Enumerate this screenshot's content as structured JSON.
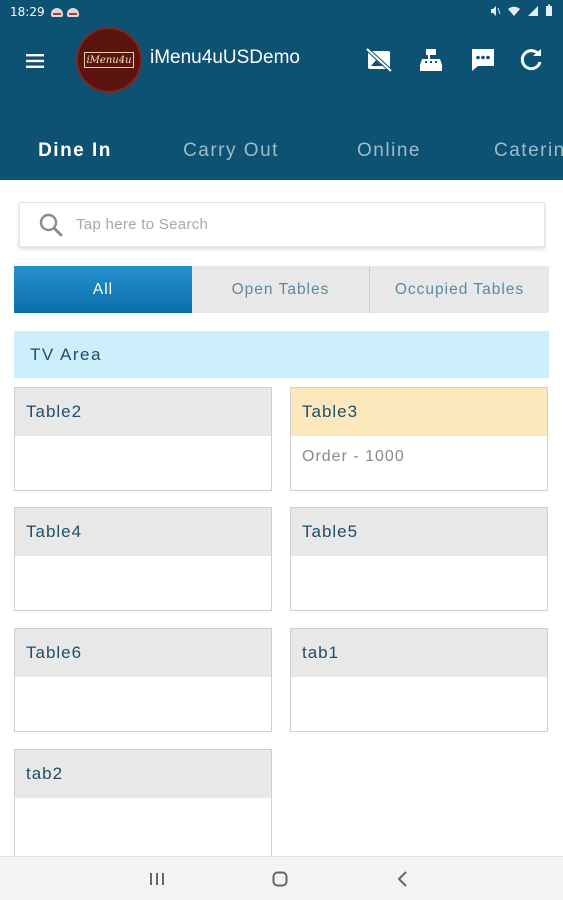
{
  "status_bar": {
    "time": "18:29"
  },
  "app": {
    "title": "iMenu4uUSDemo",
    "logo_text": "iMenu4u"
  },
  "tabs": [
    {
      "label": "Dine In",
      "active": true
    },
    {
      "label": "Carry Out",
      "active": false
    },
    {
      "label": "Online",
      "active": false
    },
    {
      "label": "Catering",
      "active": false
    }
  ],
  "search": {
    "placeholder": "Tap here to Search"
  },
  "filters": [
    {
      "label": "All",
      "active": true
    },
    {
      "label": "Open Tables",
      "active": false
    },
    {
      "label": "Occupied Tables",
      "active": false
    }
  ],
  "area": {
    "name": "TV Area"
  },
  "tables": [
    {
      "name": "Table2",
      "status": "open",
      "detail": ""
    },
    {
      "name": "Table3",
      "status": "occupied",
      "detail": "Order -  1000"
    },
    {
      "name": "Table4",
      "status": "open",
      "detail": ""
    },
    {
      "name": "Table5",
      "status": "open",
      "detail": ""
    },
    {
      "name": "Table6",
      "status": "open",
      "detail": ""
    },
    {
      "name": "tab1",
      "status": "open",
      "detail": ""
    },
    {
      "name": "tab2",
      "status": "open",
      "detail": ""
    }
  ],
  "colors": {
    "app_bar": "#0d5173",
    "tab_indicator": "#f0f000",
    "filter_active": "#1981bf",
    "area_header": "#cdeffc",
    "occupied_header": "#fbe8bd",
    "open_header": "#e8e8e8"
  },
  "icons": {
    "menu": "hamburger-icon",
    "action_1": "no-image-icon",
    "action_2": "cash-register-icon",
    "action_3": "chat-icon",
    "action_4": "refresh-icon",
    "search": "search-icon"
  }
}
